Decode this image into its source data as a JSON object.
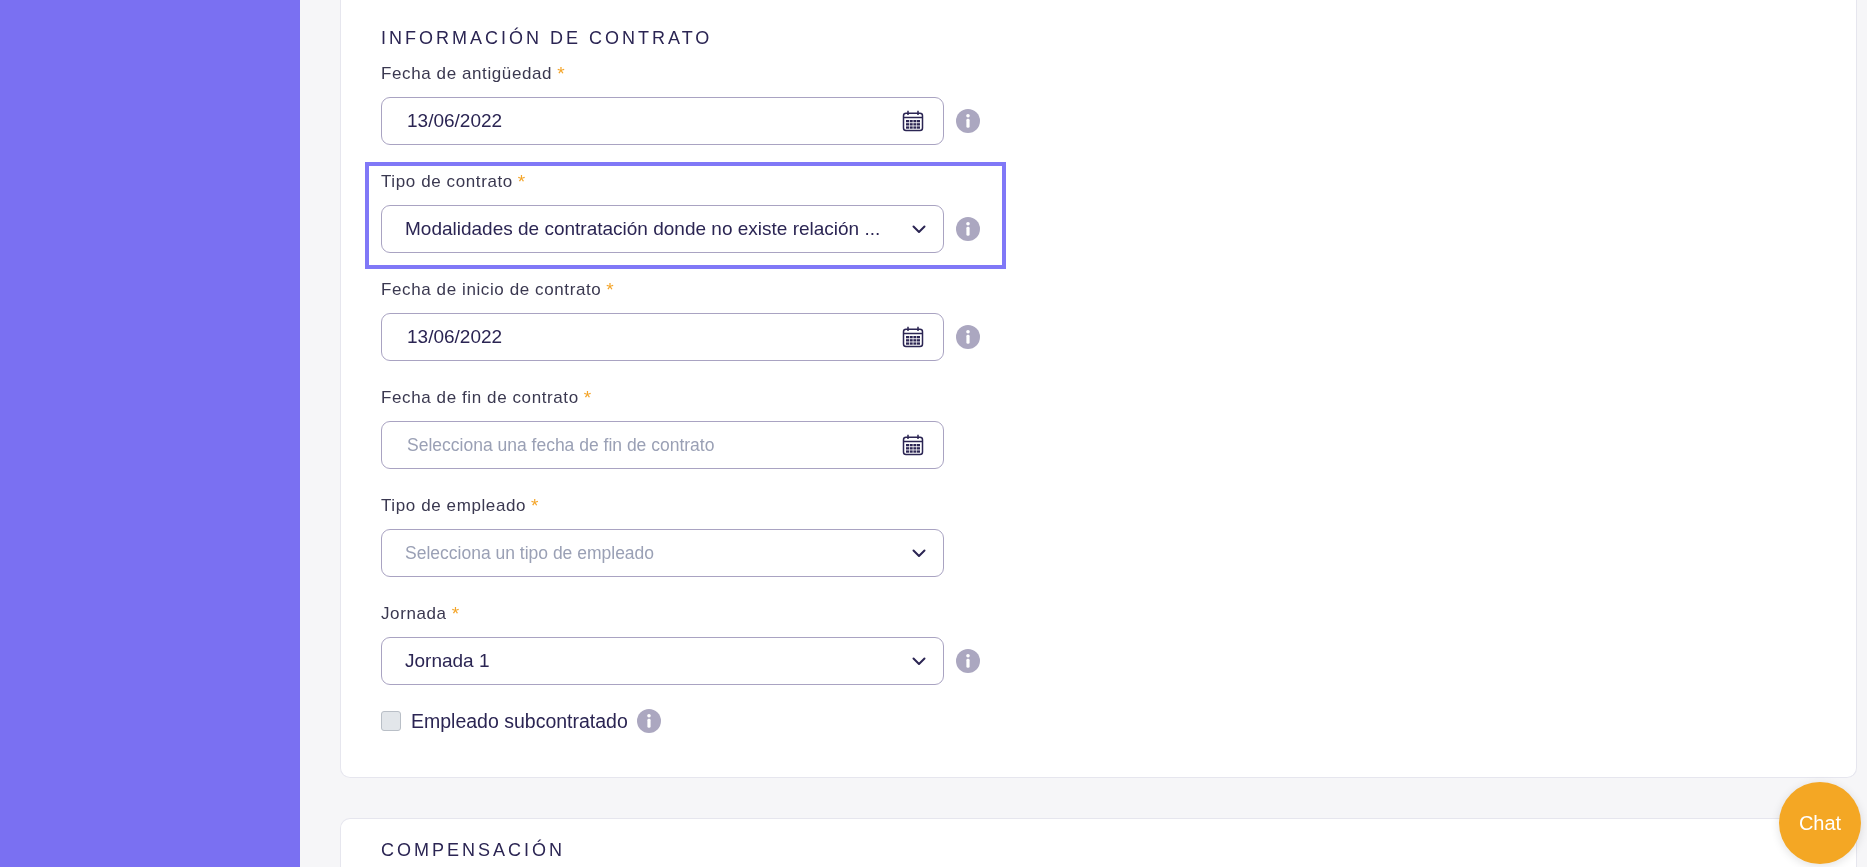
{
  "sections": [
    {
      "title": "INFORMACIÓN DE CONTRATO",
      "fields": [
        {
          "kind": "date",
          "label": "Fecha de antigüedad",
          "required_mark": "*",
          "value": "13/06/2022",
          "info": true,
          "focused": false
        },
        {
          "kind": "select",
          "label": "Tipo de contrato",
          "required_mark": "*",
          "value": "Modalidades de contratación donde no existe relación ...",
          "info": true,
          "focused": true
        },
        {
          "kind": "date",
          "label": "Fecha de inicio de contrato",
          "required_mark": "*",
          "value": "13/06/2022",
          "info": true,
          "focused": false
        },
        {
          "kind": "date",
          "label": "Fecha de fin de contrato",
          "required_mark": "*",
          "placeholder": "Selecciona una fecha de fin de contrato",
          "info": false,
          "focused": false
        },
        {
          "kind": "select",
          "label": "Tipo de empleado",
          "required_mark": "*",
          "placeholder": "Selecciona un tipo de empleado",
          "info": false,
          "focused": false
        },
        {
          "kind": "select",
          "label": "Jornada",
          "required_mark": "*",
          "value": "Jornada 1",
          "info": true,
          "focused": false
        }
      ],
      "checkbox": {
        "label": "Empleado subcontratado",
        "checked": false,
        "info": true
      }
    },
    {
      "title": "COMPENSACIÓN"
    }
  ],
  "chat_button": {
    "label": "Chat"
  }
}
